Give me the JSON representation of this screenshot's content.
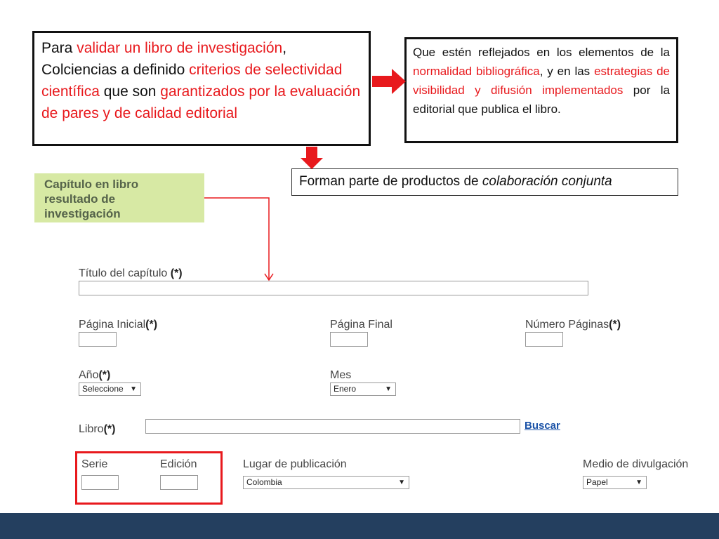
{
  "annotations": {
    "box1": {
      "t1": "Para ",
      "t2": "validar un libro de investigación",
      "t3": ", Colciencias a definido ",
      "t4": "criterios de selectividad científica",
      "t5": " que son ",
      "t6": "garantizados por la evaluación de pares y de calidad editorial"
    },
    "box2": {
      "t1": "Que estén reflejados en los elementos de la ",
      "t2": "normalidad bibliográfica",
      "t3": ", y en las ",
      "t4": "estrategias de visibilidad y difusión implementados",
      "t5": " por la editorial que publica el libro."
    },
    "box3": {
      "t1": "Forman parte de productos de ",
      "t2": "colaboración conjunta"
    }
  },
  "category_label": "Capítulo en libro resultado de investigación",
  "form": {
    "titulo_label": "Título del capítulo",
    "required": "(*)",
    "pagina_inicial_label": "Página Inicial",
    "pagina_final_label": "Página Final",
    "numero_paginas_label": "Número Páginas",
    "anio_label": "Año",
    "anio_value": "Seleccione",
    "mes_label": "Mes",
    "mes_value": "Enero",
    "libro_label": "Libro",
    "buscar_link": "Buscar",
    "serie_label": "Serie",
    "edicion_label": "Edición",
    "lugar_label": "Lugar de publicación",
    "lugar_value": "Colombia",
    "medio_label": "Medio de divulgación",
    "medio_value": "Papel",
    "dropdown_arrow": "▼"
  },
  "colors": {
    "highlight_red": "#e8191d",
    "label_green": "#d7e9a4",
    "footer_navy": "#243f5f",
    "link_blue": "#1a52a7"
  }
}
